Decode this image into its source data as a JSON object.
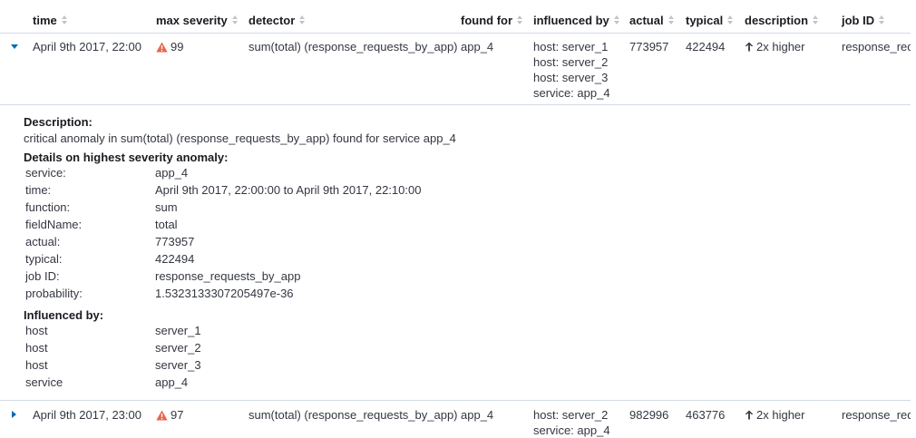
{
  "columns": {
    "time": "time",
    "max_severity": "max severity",
    "detector": "detector",
    "found_for": "found for",
    "influenced_by": "influenced by",
    "actual": "actual",
    "typical": "typical",
    "description": "description",
    "job_id": "job ID"
  },
  "colors": {
    "accent": "#006bb8",
    "severity": "#e7664c",
    "border": "#d3dae6"
  },
  "rows": [
    {
      "time": "April 9th 2017, 22:00",
      "severity": "99",
      "detector": "sum(total) (response_requests_by_app)",
      "found_for": "app_4",
      "influencers": [
        "host: server_1",
        "host: server_2",
        "host: server_3",
        "service: app_4"
      ],
      "actual": "773957",
      "typical": "422494",
      "description": "2x higher",
      "job_id": "response_req"
    },
    {
      "time": "April 9th 2017, 23:00",
      "severity": "97",
      "detector": "sum(total) (response_requests_by_app)",
      "found_for": "app_4",
      "influencers": [
        "host: server_2",
        "service: app_4"
      ],
      "actual": "982996",
      "typical": "463776",
      "description": "2x higher",
      "job_id": "response_req"
    }
  ],
  "details": {
    "description_heading": "Description:",
    "description_text": "critical anomaly in sum(total) (response_requests_by_app) found for service app_4",
    "highest_heading": "Details on highest severity anomaly:",
    "fields": [
      {
        "label": "service:",
        "value": "app_4"
      },
      {
        "label": "time:",
        "value": "April 9th 2017, 22:00:00 to April 9th 2017, 22:10:00"
      },
      {
        "label": "function:",
        "value": "sum"
      },
      {
        "label": "fieldName:",
        "value": "total"
      },
      {
        "label": "actual:",
        "value": "773957"
      },
      {
        "label": "typical:",
        "value": "422494"
      },
      {
        "label": "job ID:",
        "value": "response_requests_by_app"
      },
      {
        "label": "probability:",
        "value": "1.5323133307205497e-36"
      }
    ],
    "influenced_heading": "Influenced by:",
    "influencers": [
      {
        "label": "host",
        "value": "server_1"
      },
      {
        "label": "host",
        "value": "server_2"
      },
      {
        "label": "host",
        "value": "server_3"
      },
      {
        "label": "service",
        "value": "app_4"
      }
    ]
  }
}
